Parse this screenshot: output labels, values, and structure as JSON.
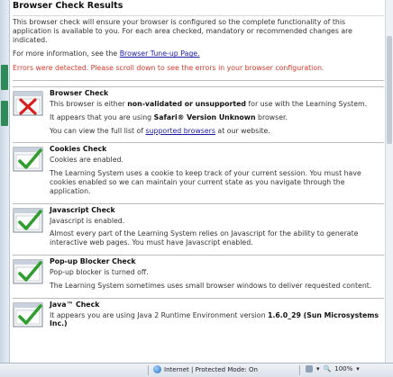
{
  "page": {
    "title": "Browser Check Results",
    "intro": "This browser check will ensure your browser is configured so the complete functionality of this application is available to you. For each area checked, mandatory or recommended changes are indicated.",
    "more_info_prefix": "For more information, see the ",
    "more_info_link": "Browser Tune-up Page.",
    "errors_text": "Errors were detected. Please scroll down to see the errors in your browser configuration."
  },
  "checks": [
    {
      "title": "Browser Check",
      "status": "fail",
      "line1_a": "This browser is either ",
      "line1_b": "non-validated or unsupported",
      "line1_c": " for use with the Learning System.",
      "line2_a": "It appears that you are using ",
      "line2_b": "Safari® Version Unknown",
      "line2_c": " browser.",
      "line3_a": "You can view the full list of ",
      "line3_link": "supported browsers",
      "line3_c": " at our website."
    },
    {
      "title": "Cookies Check",
      "status": "pass",
      "line1": "Cookies are enabled.",
      "line2": "The Learning System uses a cookie to keep track of your current session. You must have cookies enabled so we can maintain your current state as you navigate through the application."
    },
    {
      "title": "Javascript Check",
      "status": "pass",
      "line1": "Javascript is enabled.",
      "line2": "Almost every part of the Learning System relies on Javascript for the ability to generate interactive web pages. You must have Javascript enabled."
    },
    {
      "title": "Pop-up Blocker Check",
      "status": "pass",
      "line1": "Pop-up blocker is turned off.",
      "line2": "The Learning System sometimes uses small browser windows to deliver requested content."
    },
    {
      "title": "Java™ Check",
      "status": "pass",
      "line1_a": "It appears you are using Java 2 Runtime Environment version ",
      "line1_b": "1.6.0_29 (Sun Microsystems Inc.)"
    }
  ],
  "statusbar": {
    "zone": "Internet | Protected Mode: On",
    "zoom": "100%"
  },
  "colors": {
    "error": "#d43a2a",
    "link": "#1a1aa8",
    "check_green": "#2f9e2f",
    "fail_red": "#d61f1f"
  }
}
